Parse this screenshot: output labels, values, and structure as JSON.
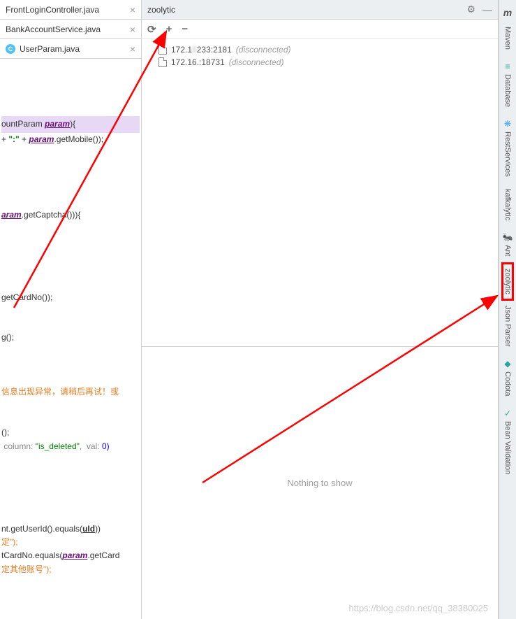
{
  "tabs": [
    {
      "label": "FrontLoginController.java",
      "hasIcon": false
    },
    {
      "label": "BankAccountService.java",
      "hasIcon": false
    },
    {
      "label": "UserParam.java",
      "hasIcon": true,
      "iconLetter": "C"
    }
  ],
  "code": {
    "line1_a": "ountParam ",
    "line1_b": "param",
    "line1_c": "){",
    "line2_a": "+ ",
    "line2_b": "\":\"",
    "line2_c": " + ",
    "line2_d": "param",
    "line2_e": ".getMobile());",
    "line3_a": "aram",
    "line3_b": ".getCaptcha())){",
    "line4": "getCardNo());",
    "line5": "g();",
    "line6": "信息出现异常，请稍后再试！或",
    "line7": "();",
    "line8_a": " column: ",
    "line8_b": "\"is_deleted\"",
    "line8_c": ",  val: ",
    "line8_d": "0)",
    "line9_a": "nt.getUserId().equals(",
    "line9_b": "uId",
    "line9_c": "))",
    "line10": "定\");",
    "line11_a": "tCardNo.equals(",
    "line11_b": "param",
    "line11_c": ".getCard",
    "line12": "定其他账号\");"
  },
  "panel": {
    "title": "zoolytic",
    "tree": [
      {
        "addr1": "172.1",
        "addr_blur": "0",
        "addr2": "233:2181",
        "status": "(disconnected)"
      },
      {
        "addr1": "172.16.",
        "addr_blur": "",
        "addr2": ":18731",
        "status": "(disconnected)"
      }
    ],
    "bottom_message": "Nothing to show"
  },
  "sidebar": {
    "logo": "m",
    "items": [
      {
        "label": "Maven",
        "icon": "",
        "highlighted": false
      },
      {
        "label": "Database",
        "icon": "≡",
        "highlighted": false
      },
      {
        "label": "RestServices",
        "icon": "❋",
        "highlighted": false
      },
      {
        "label": "kafkalytic",
        "icon": "",
        "highlighted": false
      },
      {
        "label": "Ant",
        "icon": "🐜",
        "highlighted": false
      },
      {
        "label": "zoolytic",
        "icon": "",
        "highlighted": true
      },
      {
        "label": "Json Parser",
        "icon": "",
        "highlighted": false
      },
      {
        "label": "Codota",
        "icon": "◆",
        "highlighted": false
      },
      {
        "label": "Bean Validation",
        "icon": "✓",
        "highlighted": false
      }
    ]
  },
  "watermark": "https://blog.csdn.net/qq_38380025"
}
